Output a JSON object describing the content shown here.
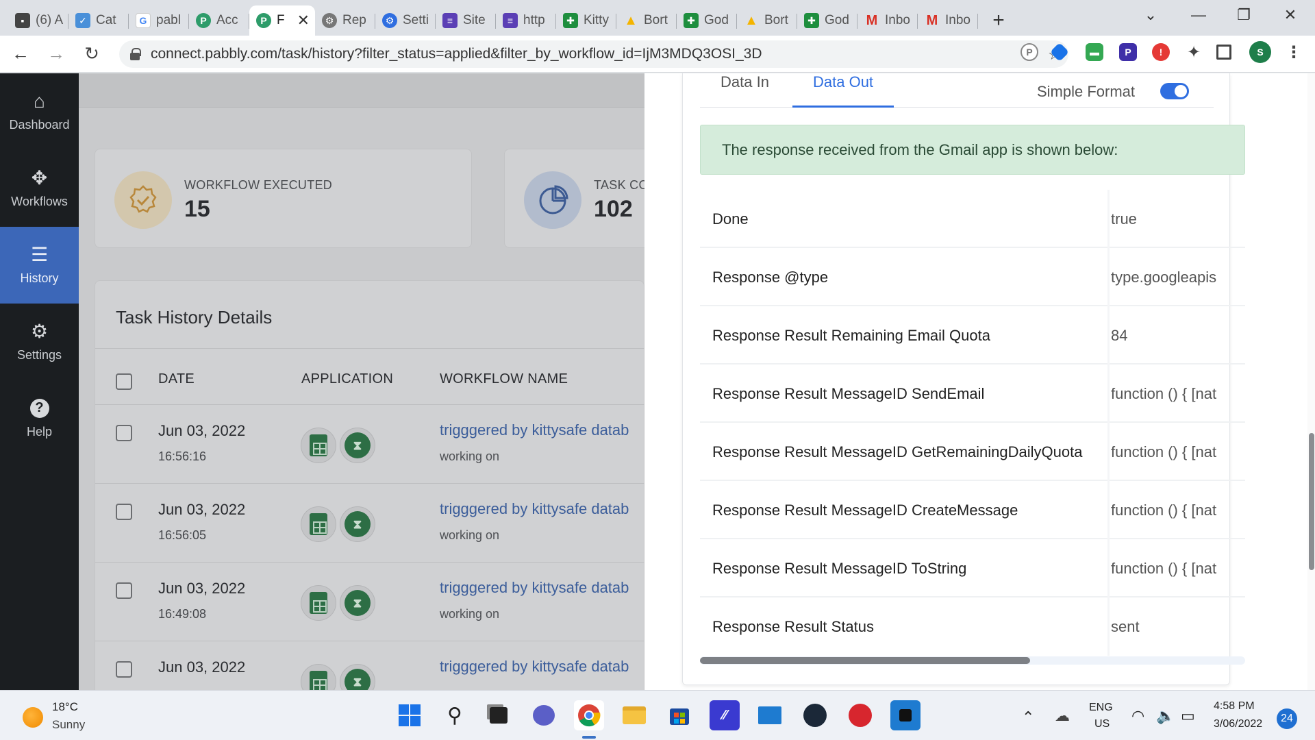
{
  "browser": {
    "tabs": [
      {
        "label": "(6) A",
        "icon": "doc-icon",
        "color": "#444444"
      },
      {
        "label": "Cat",
        "icon": "shield-icon",
        "color": "#4a90d9"
      },
      {
        "label": "pabl",
        "icon": "google-icon",
        "color": "#ffffff"
      },
      {
        "label": "Acc",
        "icon": "pabbly-icon",
        "color": "#2e9c6a"
      },
      {
        "label": "F",
        "icon": "pabbly-icon",
        "color": "#2e9c6a",
        "active": true
      },
      {
        "label": "Rep",
        "icon": "gear-icon",
        "color": "#666666"
      },
      {
        "label": "Setti",
        "icon": "gear-icon",
        "color": "#2f6ee0"
      },
      {
        "label": "Site",
        "icon": "form-icon",
        "color": "#5b3fb5"
      },
      {
        "label": "http",
        "icon": "form-icon",
        "color": "#5b3fb5"
      },
      {
        "label": "Kitty",
        "icon": "sheets-icon",
        "color": "#1e8e3e"
      },
      {
        "label": "Bort",
        "icon": "drive-icon",
        "color": "#f4b400"
      },
      {
        "label": "God",
        "icon": "sheets-icon",
        "color": "#1e8e3e"
      },
      {
        "label": "Bort",
        "icon": "drive-icon",
        "color": "#f4b400"
      },
      {
        "label": "God",
        "icon": "sheets-icon",
        "color": "#1e8e3e"
      },
      {
        "label": "Inbo",
        "icon": "gmail-icon",
        "color": "#d93025"
      },
      {
        "label": "Inbo",
        "icon": "gmail-icon",
        "color": "#d93025"
      }
    ],
    "url": "connect.pabbly.com/task/history?filter_status=applied&filter_by_workflow_id=IjM3MDQ3OSI_3D",
    "profile_initial": "S"
  },
  "sidebar": {
    "items": [
      {
        "label": "Dashboard",
        "icon": "home-icon"
      },
      {
        "label": "Workflows",
        "icon": "puzzle-icon"
      },
      {
        "label": "History",
        "icon": "list-icon",
        "active": true
      },
      {
        "label": "Settings",
        "icon": "gear-icon"
      },
      {
        "label": "Help",
        "icon": "help-icon"
      }
    ]
  },
  "stats": [
    {
      "label": "WORKFLOW EXECUTED",
      "value": "15",
      "icon": "badge-check-icon"
    },
    {
      "label": "TASK CO",
      "value": "102",
      "icon": "pie-chart-icon"
    }
  ],
  "task_history": {
    "title": "Task History Details",
    "columns": [
      "DATE",
      "APPLICATION",
      "WORKFLOW NAME"
    ],
    "rows": [
      {
        "date": "Jun 03, 2022",
        "time": "16:56:16",
        "workflow": "trigggered by kittysafe datab",
        "status": "working on"
      },
      {
        "date": "Jun 03, 2022",
        "time": "16:56:05",
        "workflow": "trigggered by kittysafe datab",
        "status": "working on"
      },
      {
        "date": "Jun 03, 2022",
        "time": "16:49:08",
        "workflow": "trigggered by kittysafe datab",
        "status": "working on"
      },
      {
        "date": "Jun 03, 2022",
        "time": "",
        "workflow": "trigggered by kittysafe datab",
        "status": ""
      }
    ]
  },
  "drawer": {
    "tabs": [
      "Data In",
      "Data Out"
    ],
    "active_tab": "Data Out",
    "format_label": "Simple Format",
    "format_enabled": true,
    "notice": "The response received from the Gmail app is shown below:",
    "fields": [
      {
        "key": "Done",
        "value": "true"
      },
      {
        "key": "Response @type",
        "value": "type.googleapis"
      },
      {
        "key": "Response Result Remaining Email Quota",
        "value": "84"
      },
      {
        "key": "Response Result MessageID SendEmail",
        "value": "function () { [nat"
      },
      {
        "key": "Response Result MessageID GetRemainingDailyQuota",
        "value": "function () { [nat"
      },
      {
        "key": "Response Result MessageID CreateMessage",
        "value": "function () { [nat"
      },
      {
        "key": "Response Result MessageID ToString",
        "value": "function () { [nat"
      },
      {
        "key": "Response Result Status",
        "value": "sent"
      }
    ]
  },
  "taskbar": {
    "temperature": "18°C",
    "weather": "Sunny",
    "lang_top": "ENG",
    "lang_bottom": "US",
    "time": "4:58 PM",
    "date": "3/06/2022",
    "notifications": "24"
  }
}
